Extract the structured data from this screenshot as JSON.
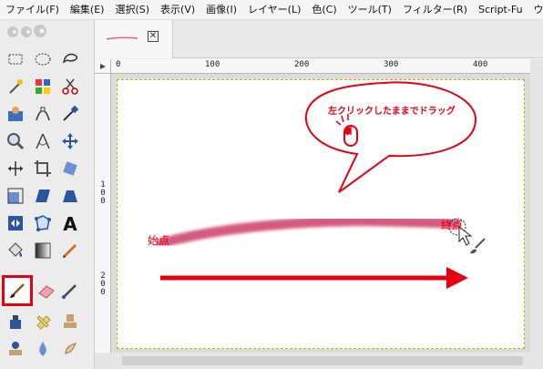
{
  "menu": {
    "items": [
      "ファイル(F)",
      "編集(E)",
      "選択(S)",
      "表示(V)",
      "画像(I)",
      "レイヤー(L)",
      "色(C)",
      "ツール(T)",
      "フィルター(R)",
      "Script-Fu",
      "ウィン"
    ]
  },
  "toolbox": {
    "tools": [
      {
        "name": "rect-select-icon"
      },
      {
        "name": "ellipse-select-icon"
      },
      {
        "name": "free-select-icon"
      },
      {
        "name": "fuzzy-select-icon"
      },
      {
        "name": "color-select-icon"
      },
      {
        "name": "scissors-select-icon"
      },
      {
        "name": "foreground-select-icon"
      },
      {
        "name": "paths-icon"
      },
      {
        "name": "color-picker-icon"
      },
      {
        "name": "zoom-icon"
      },
      {
        "name": "measure-icon"
      },
      {
        "name": "move-icon"
      },
      {
        "name": "align-icon"
      },
      {
        "name": "crop-icon"
      },
      {
        "name": "rotate-icon"
      },
      {
        "name": "scale-icon"
      },
      {
        "name": "shear-icon"
      },
      {
        "name": "perspective-icon"
      },
      {
        "name": "flip-icon"
      },
      {
        "name": "cage-icon"
      },
      {
        "name": "text-icon"
      },
      {
        "name": "bucket-fill-icon"
      },
      {
        "name": "blend-icon"
      },
      {
        "name": "pencil-icon"
      },
      {
        "name": "paintbrush-icon"
      },
      {
        "name": "eraser-icon"
      },
      {
        "name": "airbrush-icon"
      },
      {
        "name": "ink-icon"
      },
      {
        "name": "heal-icon"
      },
      {
        "name": "clone-icon"
      },
      {
        "name": "perspective-clone-icon"
      },
      {
        "name": "blur-icon"
      },
      {
        "name": "smudge-icon"
      }
    ],
    "active": "paintbrush-icon"
  },
  "image_window": {
    "tab_close": "✕",
    "ruler_marks": [
      "0",
      "100",
      "200",
      "300",
      "400"
    ],
    "vruler_marks": [
      "1\n0\n0",
      "2\n0\n0"
    ]
  },
  "annotations": {
    "start_label": "始点",
    "end_label": "終点",
    "bubble_text": "左クリックしたままでドラッグ"
  },
  "colors": {
    "accent_red": "#e60012",
    "stroke_pink": "#d04a72"
  }
}
